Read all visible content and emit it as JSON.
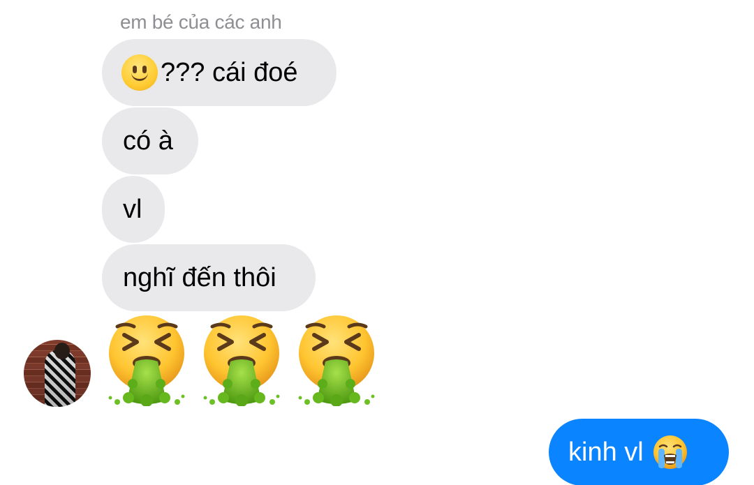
{
  "conversation": {
    "sender_name": "em bé của các anh",
    "incoming": [
      {
        "emoji": "slightly-smiling-face",
        "text": "??? cái đoé"
      },
      {
        "text": "có à"
      },
      {
        "text": "vl"
      },
      {
        "text": "nghĩ đến thôi"
      }
    ],
    "sticker_row": {
      "emoji": "face-vomiting",
      "count": 3
    },
    "outgoing": [
      {
        "text": "kinh vl",
        "emoji": "loudly-crying-face"
      }
    ]
  },
  "colors": {
    "incoming_bubble": "#e9e9eb",
    "outgoing_bubble": "#0b84ff",
    "sender_name": "#8e8e93",
    "background": "#ffffff"
  }
}
